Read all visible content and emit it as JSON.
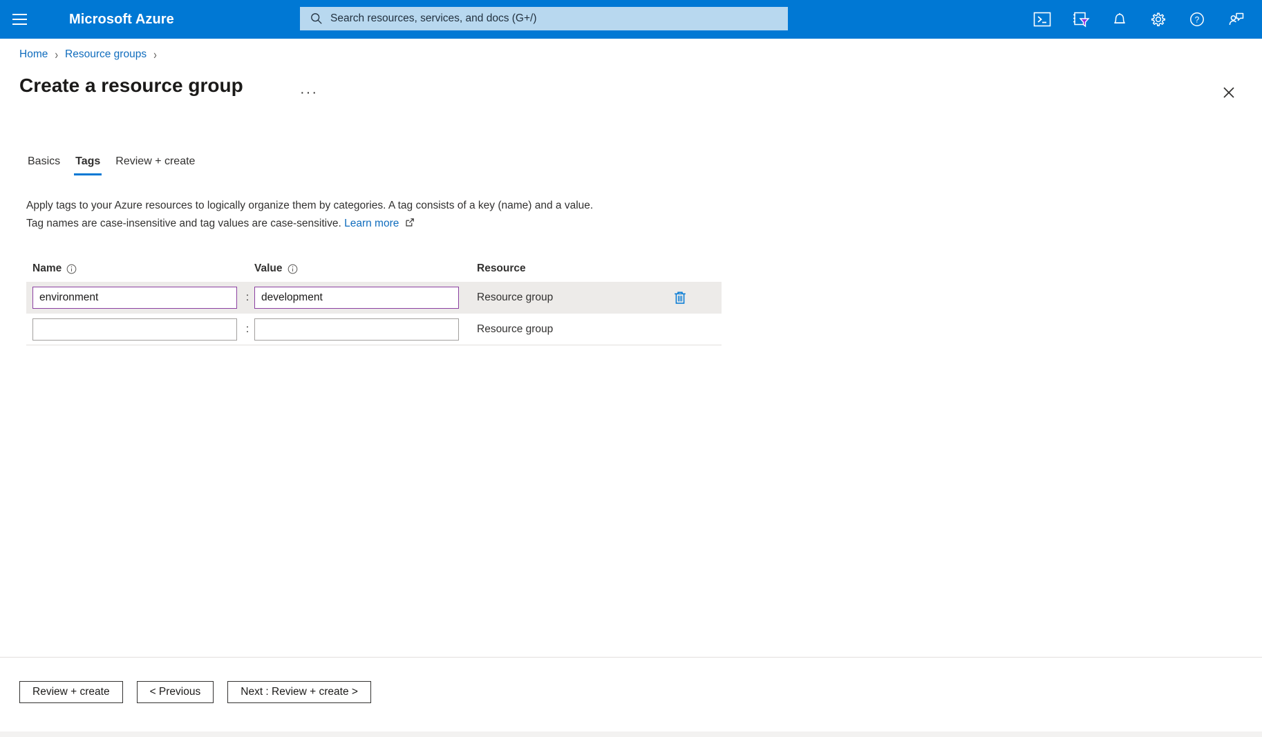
{
  "topbar": {
    "menu_icon": "hamburger-icon",
    "brand": "Microsoft Azure",
    "search": {
      "icon": "search-icon",
      "placeholder": "Search resources, services, and docs (G+/)",
      "value": ""
    },
    "icons": [
      {
        "name": "cloud-shell-icon",
        "label": "Cloud Shell"
      },
      {
        "name": "directories-subscriptions-icon",
        "label": "Directories + subscriptions"
      },
      {
        "name": "notifications-bell-icon",
        "label": "Notifications"
      },
      {
        "name": "settings-gear-icon",
        "label": "Settings"
      },
      {
        "name": "help-question-icon",
        "label": "Help"
      },
      {
        "name": "feedback-person-icon",
        "label": "Feedback"
      }
    ],
    "accent_color": "#0078d4",
    "search_background": "#b8d8ef"
  },
  "breadcrumb": [
    {
      "label": "Home"
    },
    {
      "label": "Resource groups"
    }
  ],
  "page": {
    "title": "Create a resource group",
    "more_menu": "···",
    "close_icon": "close-icon"
  },
  "tabs": [
    {
      "label": "Basics",
      "selected": false
    },
    {
      "label": "Tags",
      "selected": true
    },
    {
      "label": "Review + create",
      "selected": false
    }
  ],
  "description": {
    "line1": "Apply tags to your Azure resources to logically organize them by categories. A tag consists of a key (name) and a value.",
    "line2_before": "Tag names are case-insensitive and tag values are case-sensitive.",
    "link_text": "Learn more",
    "link_icon": "external-link-icon"
  },
  "tag_table": {
    "headers": {
      "name": "Name",
      "value": "Value",
      "resource": "Resource",
      "name_info_icon": "info-icon",
      "value_info_icon": "info-icon"
    },
    "separator": ":",
    "rows": [
      {
        "name": "environment",
        "value": "development",
        "resource": "Resource group",
        "has_delete": true,
        "delete_icon": "delete-trash-icon",
        "highlighted": true,
        "name_placeholder": "",
        "value_placeholder": ""
      },
      {
        "name": "",
        "value": "",
        "resource": "Resource group",
        "has_delete": false,
        "delete_icon": "",
        "highlighted": false,
        "name_placeholder": "",
        "value_placeholder": ""
      }
    ],
    "input_accent_color": "#8a3fa0",
    "row_highlight_color": "#edebe9",
    "delete_icon_color": "#0078d4"
  },
  "footer": {
    "buttons": [
      {
        "label": "Review + create",
        "name": "review-create-button"
      },
      {
        "label": "< Previous",
        "name": "previous-button"
      },
      {
        "label": "Next : Review + create >",
        "name": "next-review-create-button"
      }
    ]
  },
  "colors": {
    "link": "#0f6cbd",
    "text": "#323130",
    "title": "#1b1a19"
  }
}
